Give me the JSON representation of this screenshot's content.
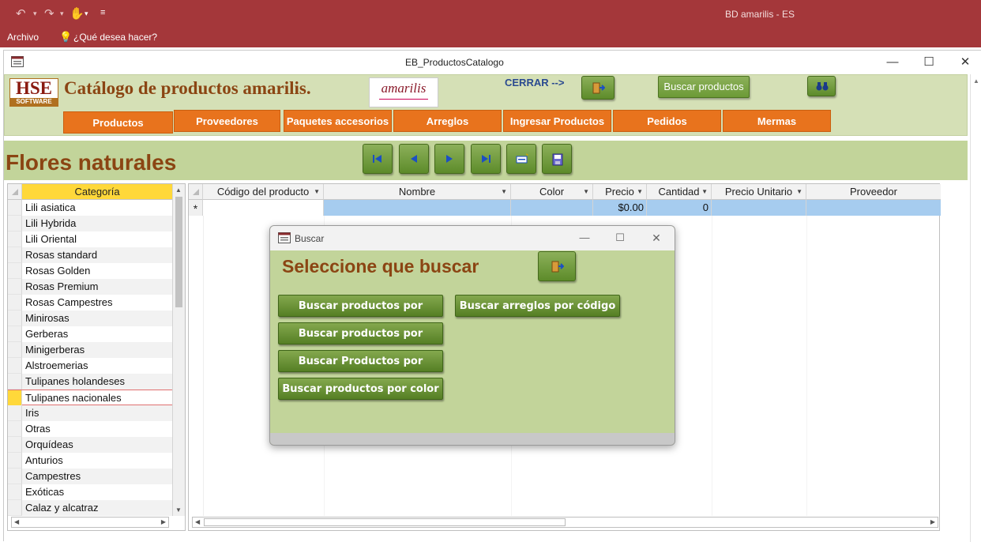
{
  "app": {
    "title": "BD amarilis - ES",
    "menu_file": "Archivo",
    "tell_me": "¿Qué desea hacer?"
  },
  "form": {
    "window_title": "EB_ProductosCatalogo",
    "logo_text": "HSE",
    "logo_sub": "SOFTWARE",
    "title": "Catálogo de productos amarilis.",
    "brand_logo_text": "amarilis",
    "close_label": "CERRAR -->",
    "search_button": "Buscar productos",
    "nav": [
      "Productos",
      "Proveedores",
      "Paquetes accesorios",
      "Arreglos",
      "Ingresar Productos",
      "Pedidos",
      "Mermas"
    ],
    "section_title": "Flores naturales"
  },
  "categories": {
    "header": "Categoría",
    "items": [
      "Lili asiatica",
      "Lili Hybrida",
      "Lili Oriental",
      "Rosas standard",
      "Rosas Golden",
      "Rosas Premium",
      "Rosas Campestres",
      "Minirosas",
      "Gerberas",
      "Minigerberas",
      "Alstroemerias",
      "Tulipanes holandeses",
      "Tulipanes nacionales",
      "Iris",
      "Otras",
      "Orquídeas",
      "Anturios",
      "Campestres",
      "Exóticas",
      "Calaz y alcatraz"
    ],
    "selected_index": 12
  },
  "grid": {
    "columns": [
      "Código del producto",
      "Nombre",
      "Color",
      "Precio",
      "Cantidad",
      "Precio Unitario",
      "Proveedor"
    ],
    "new_row": {
      "marker": "*",
      "precio": "$0.00",
      "cantidad": "0"
    }
  },
  "dialog": {
    "title": "Buscar",
    "heading": "Seleccione que buscar",
    "buttons": [
      "Buscar productos por clases",
      "Buscar arreglos por código",
      "Buscar productos por categorías",
      "Buscar Productos por nombre",
      "Buscar productos por color"
    ]
  },
  "colors": {
    "title_bar": "#a4373a",
    "header_bg": "#d5e0b6",
    "nav_orange": "#e8731d",
    "dialog_bg": "#c2d49a",
    "heading_brown": "#8b4513"
  }
}
